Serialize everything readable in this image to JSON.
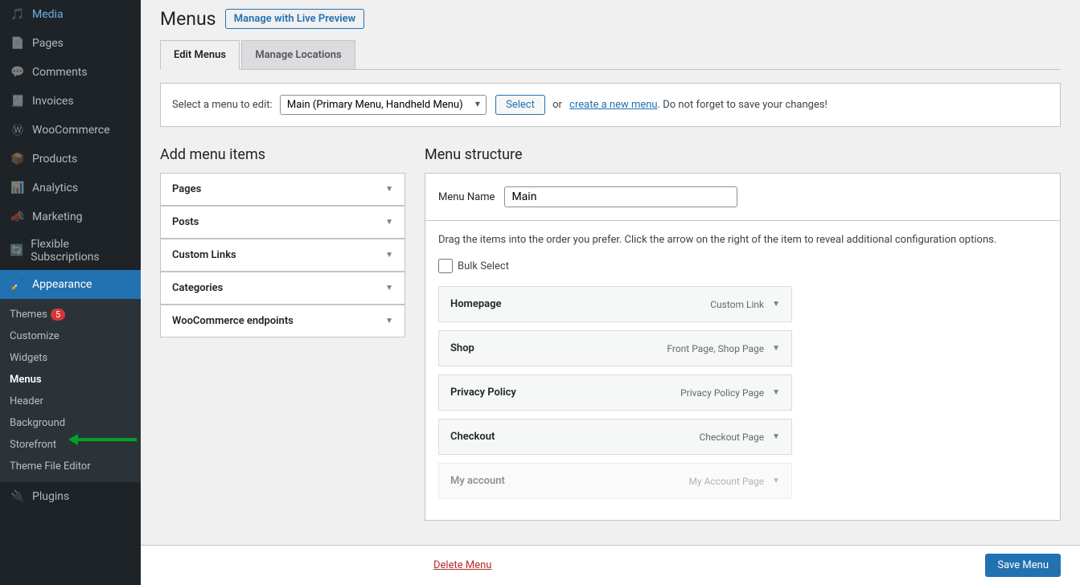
{
  "sidebar": {
    "items": [
      {
        "label": "Media"
      },
      {
        "label": "Pages"
      },
      {
        "label": "Comments"
      },
      {
        "label": "Invoices"
      },
      {
        "label": "WooCommerce"
      },
      {
        "label": "Products"
      },
      {
        "label": "Analytics"
      },
      {
        "label": "Marketing"
      },
      {
        "label": "Flexible Subscriptions"
      },
      {
        "label": "Appearance"
      },
      {
        "label": "Plugins"
      }
    ],
    "appearance_submenu": [
      {
        "label": "Themes",
        "badge": "5"
      },
      {
        "label": "Customize"
      },
      {
        "label": "Widgets"
      },
      {
        "label": "Menus"
      },
      {
        "label": "Header"
      },
      {
        "label": "Background"
      },
      {
        "label": "Storefront"
      },
      {
        "label": "Theme File Editor"
      }
    ]
  },
  "header": {
    "title": "Menus",
    "preview_button": "Manage with Live Preview"
  },
  "tabs": [
    {
      "label": "Edit Menus"
    },
    {
      "label": "Manage Locations"
    }
  ],
  "manage_menus": {
    "label": "Select a menu to edit:",
    "selected": "Main (Primary Menu, Handheld Menu)",
    "select_button": "Select",
    "or_text": "or",
    "create_link": "create a new menu",
    "trailing": ". Do not forget to save your changes!"
  },
  "left": {
    "heading": "Add menu items",
    "accordions": [
      "Pages",
      "Posts",
      "Custom Links",
      "Categories",
      "WooCommerce endpoints"
    ]
  },
  "right": {
    "heading": "Menu structure",
    "name_label": "Menu Name",
    "name_value": "Main",
    "instruction": "Drag the items into the order you prefer. Click the arrow on the right of the item to reveal additional configuration options.",
    "bulk_label": "Bulk Select",
    "menu_items": [
      {
        "title": "Homepage",
        "type": "Custom Link"
      },
      {
        "title": "Shop",
        "type": "Front Page, Shop Page"
      },
      {
        "title": "Privacy Policy",
        "type": "Privacy Policy Page"
      },
      {
        "title": "Checkout",
        "type": "Checkout Page"
      },
      {
        "title": "My account",
        "type": "My Account Page"
      }
    ]
  },
  "footer": {
    "delete": "Delete Menu",
    "save": "Save Menu"
  }
}
